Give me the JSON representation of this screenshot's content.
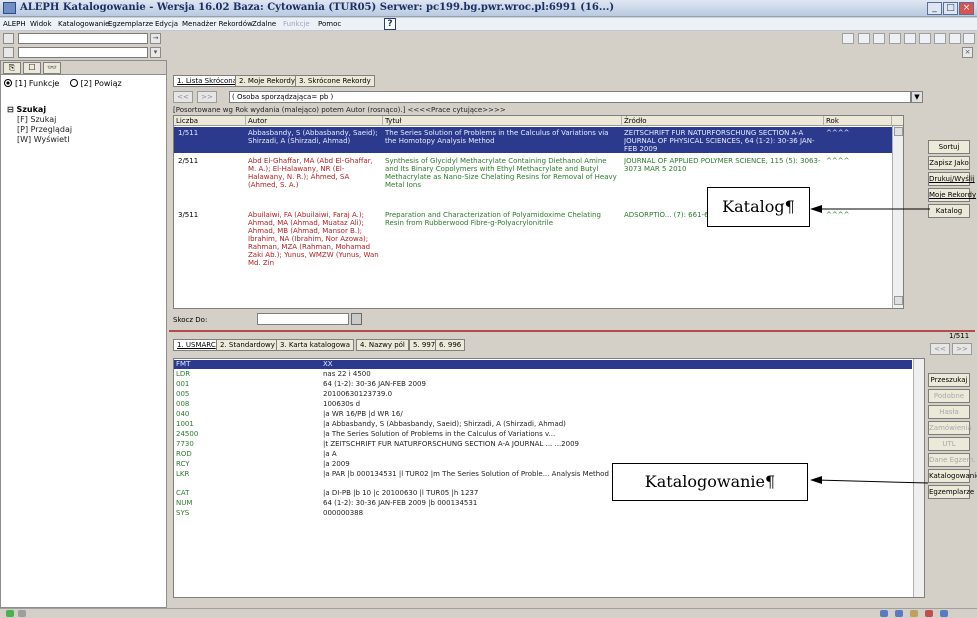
{
  "window": {
    "title": "ALEPH Katalogowanie - Wersja 16.02        Baza:  Cytowania (TUR05)        Serwer:  pc199.bg.pwr.wroc.pl:6991 (16...)"
  },
  "menu": {
    "items": [
      "ALEPH",
      "Widok",
      "Katalogowanie",
      "Egzemplarze",
      "Edycja",
      "Menadżer Rekordów",
      "Zdalne",
      "Funkcje",
      "Pomoc"
    ],
    "help_icon": "?"
  },
  "left_panel": {
    "tab_icons": [
      "clipboard-icon",
      "window-icon",
      "binoculars-icon"
    ],
    "tab_glyphs": [
      "⎘",
      "☐",
      "👓"
    ],
    "radios": [
      "[1] Funkcje",
      "[2] Powiąz"
    ],
    "tree_root": "Szukaj",
    "tree_items": [
      "[F] Szukaj",
      "[P] Przeglądaj",
      "[W] Wyświetl"
    ]
  },
  "top_section": {
    "tabs": [
      "1. Lista Skrócona",
      "2. Moje Rekordy",
      "3. Skrócone Rekordy"
    ],
    "nav_prev": "<<",
    "nav_next": ">>",
    "query": "( Osoba sporządzająca= pb )",
    "sort_info": "[Posortowane wg Rok wydania (malejąco) potem Autor (rosnąco).]   <<<<Prace cytujące>>>>",
    "columns": [
      "Liczba",
      "Autor",
      "Tytuł",
      "Źródło",
      "Rok"
    ],
    "rows": [
      {
        "liczba": "1/511",
        "autor": "Abbasbandy, S (Abbasbandy, Saeid); Shirzadi, A (Shirzadi, Ahmad)",
        "tytul": "The Series Solution of Problems in the Calculus of Variations via the Homotopy Analysis Method",
        "zrodlo": "ZEITSCHRIFT FUR NATURFORSCHUNG SECTION A-A JOURNAL OF PHYSICAL SCIENCES, 64 (1-2): 30-36 JAN-FEB 2009",
        "rok": "^^^^"
      },
      {
        "liczba": "2/511",
        "autor": "Abd El-Ghaffar, MA (Abd El-Ghaffar, M. A.); El-Halawany, NR (El-Halawany, N. R.); Ahmed, SA (Ahmed, S. A.)",
        "tytul": "Synthesis of Glycidyl Methacrylate Containing Diethanol Amine and Its Binary Copolymers with Ethyl Methacrylate and Butyl Methacrylate as Nano-Size Chelating Resins for Removal of Heavy Metal Ions",
        "zrodlo": "JOURNAL OF APPLIED POLYMER SCIENCE, 115 (5): 3063-3073 MAR 5 2010",
        "rok": "^^^^"
      },
      {
        "liczba": "3/511",
        "autor": "Abuilaiwi, FA (Abuilaiwi, Faraj A.); Ahmad, MA (Ahmad, Muataz Ali); Ahmad, MB (Ahmad, Mansor B.); Ibrahim, NA (Ibrahim, Nor Azowa); Rahman, MZA (Rahman, Mohamad Zaki Ab.); Yunus, WMZW (Yunus, Wan Md. Zin",
        "tytul": "Preparation and Characterization of Polyamidoxime Chelating Resin from Rubberwood Fibre-g-Polyacrylonitrile",
        "zrodlo": "ADSORPTIO... (7): 661-67...",
        "rok": "^^^^"
      }
    ],
    "skocz_label": "Skocz Do:",
    "buttons": [
      "Sortuj",
      "Zapisz Jako",
      "Drukuj/Wyślij",
      "Moje Rekordy",
      "Katalog"
    ]
  },
  "callouts": {
    "katalog": "Katalog¶",
    "katalogowanie": "Katalogowanie¶"
  },
  "bottom_section": {
    "tabs": [
      "1. USMARC",
      "2. Standardowy",
      "3. Karta katalogowa",
      "4. Nazwy pól",
      "5. 997",
      "6. 996"
    ],
    "counter": "1/511",
    "nav_prev": "<<",
    "nav_next": ">>",
    "marc_rows": [
      {
        "tag": "FMT",
        "value": "XX"
      },
      {
        "tag": "LDR",
        "value": "   nas  22    i 4500"
      },
      {
        "tag": "001",
        "value": "64 (1-2): 30-36 JAN-FEB 2009"
      },
      {
        "tag": "005",
        "value": "20100630123739.0"
      },
      {
        "tag": "008",
        "value": "100630s                   d"
      },
      {
        "tag": "040",
        "value": "|a WR 16/PB |d WR 16/"
      },
      {
        "tag": "1001",
        "value": "|a Abbasbandy, S (Abbasbandy, Saeid); Shirzadi, A (Shirzadi, Ahmad)"
      },
      {
        "tag": "24500",
        "value": "|a The Series Solution of Problems in the Calculus of Variations v..."
      },
      {
        "tag": "7730",
        "value": "|t ZEITSCHRIFT FUR NATURFORSCHUNG SECTION A-A JOURNAL ...                                               ...2009"
      },
      {
        "tag": "ROD",
        "value": "|a A"
      },
      {
        "tag": "RCY",
        "value": "|a 2009"
      },
      {
        "tag": "LKR",
        "value": "|a PAR |b 000134531 |l TUR02 |m The Series Solution of Proble...                                 Analysis Method"
      },
      {
        "tag": "CAT",
        "value": "|a DI-PB |b 10 |c 20100630 |l TUR05 |h 1237"
      },
      {
        "tag": "NUM",
        "value": "64 (1-2): 30-36 JAN-FEB 2009 |b 000134531"
      },
      {
        "tag": "SYS",
        "value": "000000388"
      }
    ],
    "buttons": [
      "Przeszukaj",
      "Podobne",
      "Hasła",
      "Zamówienia",
      "UTL",
      "Dane Egzem.",
      "Katalogowanie",
      "Egzemplarze"
    ]
  },
  "colors": {
    "selected_row": "#2b3a8d",
    "author_text": "#b02020",
    "title_text": "#2a7c2a",
    "divider": "#b44a4a"
  }
}
